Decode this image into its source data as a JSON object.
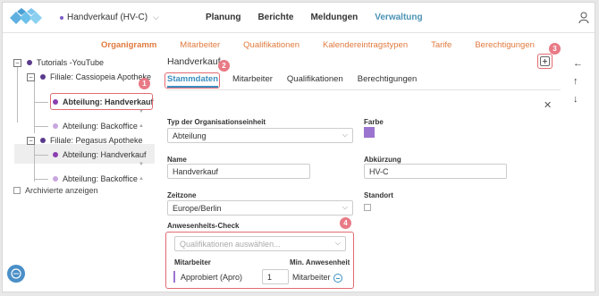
{
  "app": {
    "org_name": "Handverkauf (HV-C)",
    "nav": [
      "Planung",
      "Berichte",
      "Meldungen",
      "Verwaltung"
    ],
    "nav_active": "Verwaltung"
  },
  "subnav": [
    "Organigramm",
    "Mitarbeiter",
    "Qualifikationen",
    "Kalendereintragstypen",
    "Tarife",
    "Berechtigungen"
  ],
  "tree": {
    "root": "Tutorials -YouTube",
    "filiale1": "Filiale: Cassiopeia Apotheke",
    "abt1": "Abteilung: Handverkauf",
    "abt2": "Abteilung: Backoffice",
    "filiale2": "Filiale: Pegasus Apotheke",
    "abt3": "Abteilung: Handverkauf",
    "abt4": "Abteilung: Backoffice",
    "archive_label": "Archivierte anzeigen"
  },
  "panel": {
    "title": "Handverkauf",
    "tabs": [
      "Stammdaten",
      "Mitarbeiter",
      "Qualifikationen",
      "Berechtigungen"
    ],
    "typ_label": "Typ der Organisationseinheit",
    "typ_value": "Abteilung",
    "farbe_label": "Farbe",
    "name_label": "Name",
    "name_value": "Handverkauf",
    "abk_label": "Abkürzung",
    "abk_value": "HV-C",
    "zeitzone_label": "Zeitzone",
    "zeitzone_value": "Europe/Berlin",
    "standort_label": "Standort",
    "anw_label": "Anwesenheits-Check",
    "qual_placeholder": "Qualifikationen auswählen...",
    "mitarbeiter_col": "Mitarbeiter",
    "min_anw_col": "Min. Anwesenheit",
    "qual_name": "Approbiert (Apro)",
    "qual_count": "1",
    "qual_unit": "Mitarbeiter"
  },
  "badges": [
    "1",
    "2",
    "3",
    "4"
  ],
  "colors": {
    "accent": "#3a8fc0",
    "orange": "#e07a3e",
    "highlight": "#e36b73",
    "purple": "#9b74cf"
  }
}
